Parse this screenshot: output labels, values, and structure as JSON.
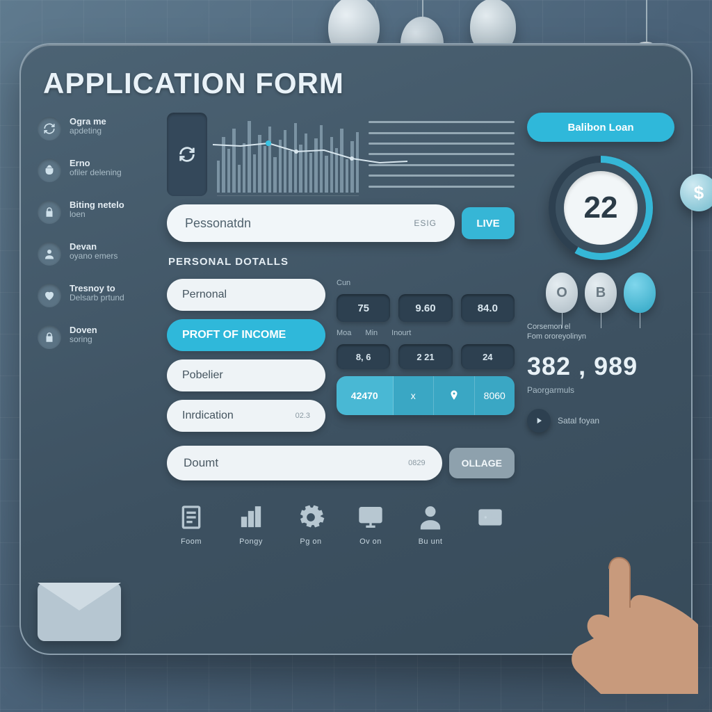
{
  "title": "APPLICATION FORM",
  "sidebar": {
    "items": [
      {
        "icon": "refresh",
        "line1": "Ogra me",
        "line2": "apdeting"
      },
      {
        "icon": "bag",
        "line1": "Erno",
        "line2": "ofiler delening"
      },
      {
        "icon": "lock",
        "line1": "Biting netelo",
        "line2": "loen"
      },
      {
        "icon": "user",
        "line1": "Devan",
        "line2": "oyano emers"
      },
      {
        "icon": "heart",
        "line1": "Tresnoy to",
        "line2": "Delsarb prtund"
      },
      {
        "icon": "lock",
        "line1": "Doven",
        "line2": "soring"
      }
    ]
  },
  "search": {
    "placeholder": "Pessonatdn",
    "right": "ESIG",
    "live": "LIVE"
  },
  "section_label": "PERSONAL DOTALLS",
  "pills": [
    {
      "label": "Pernonal",
      "active": false
    },
    {
      "label": "PROFT OF INCOME",
      "active": true
    },
    {
      "label": "Pobelier",
      "active": false
    },
    {
      "label": "Inrdication",
      "active": false,
      "tail": "02.3"
    }
  ],
  "stats": {
    "top_labels": [
      "Cun",
      "",
      ""
    ],
    "row1": [
      "75",
      "9.60",
      "84.0"
    ],
    "mid_labels": [
      "Moa",
      "Min",
      "Inourt"
    ],
    "row2": [
      "8, 6",
      "2   21",
      "24"
    ],
    "segmented": [
      "42470",
      "x",
      "pin",
      "8060"
    ]
  },
  "bottom": {
    "label": "Doumt",
    "right": "0829",
    "button": "OLLAGE"
  },
  "rail": {
    "loan_button": "Balibon Loan",
    "gauge_value": "22",
    "mini": [
      "O",
      "B"
    ],
    "caption1": "Corsemon el",
    "caption2": "Fom ororeyolinyn",
    "big_number": "382 , 989",
    "big_number_sub": "Paorgarmuls",
    "play_label": "Satal foyan"
  },
  "dock": [
    {
      "icon": "doc",
      "label": "Foom"
    },
    {
      "icon": "bars",
      "label": "Pongy"
    },
    {
      "icon": "gear",
      "label": "Pg on"
    },
    {
      "icon": "monitor",
      "label": "Ov on"
    },
    {
      "icon": "person",
      "label": "Bu unt"
    },
    {
      "icon": "card",
      "label": ""
    }
  ],
  "colors": {
    "accent": "#2fb8da",
    "panel": "#3d5161",
    "chip": "#2d4050"
  }
}
